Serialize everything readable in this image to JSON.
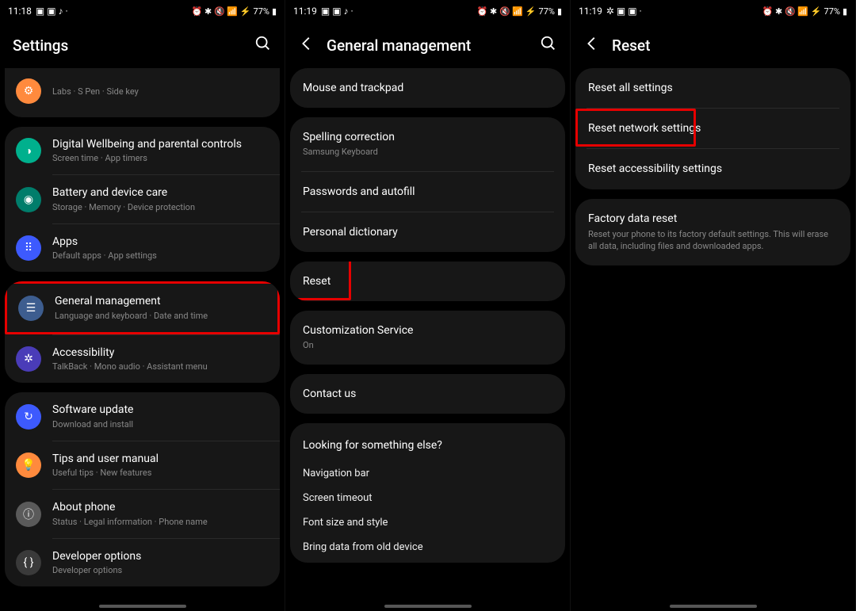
{
  "screen1": {
    "time": "11:18",
    "battery": "77%",
    "title": "Settings",
    "partial_sub": "Labs  ·  S Pen  ·  Side key",
    "items": [
      {
        "title": "Digital Wellbeing and parental controls",
        "sub": "Screen time  ·  App timers",
        "iconClass": "icon-green"
      },
      {
        "title": "Battery and device care",
        "sub": "Storage  ·  Memory  ·  Device protection",
        "iconClass": "icon-teal"
      },
      {
        "title": "Apps",
        "sub": "Default apps  ·  App settings",
        "iconClass": "icon-blue"
      }
    ],
    "items2": [
      {
        "title": "General management",
        "sub": "Language and keyboard  ·  Date and time",
        "iconClass": "icon-slate",
        "highlight": true
      },
      {
        "title": "Accessibility",
        "sub": "TalkBack  ·  Mono audio  ·  Assistant menu",
        "iconClass": "icon-purple"
      }
    ],
    "items3": [
      {
        "title": "Software update",
        "sub": "Download and install",
        "iconClass": "icon-blue"
      },
      {
        "title": "Tips and user manual",
        "sub": "Useful tips  ·  New features",
        "iconClass": "icon-orange"
      },
      {
        "title": "About phone",
        "sub": "Status  ·  Legal information  ·  Phone name",
        "iconClass": "icon-gray"
      },
      {
        "title": "Developer options",
        "sub": "Developer options",
        "iconClass": "icon-dark"
      }
    ]
  },
  "screen2": {
    "time": "11:19",
    "battery": "77%",
    "title": "General management",
    "cards": [
      [
        {
          "title": "Mouse and trackpad"
        }
      ],
      [
        {
          "title": "Spelling correction",
          "sub": "Samsung Keyboard"
        },
        {
          "title": "Passwords and autofill"
        },
        {
          "title": "Personal dictionary"
        }
      ],
      [
        {
          "title": "Reset",
          "highlight": true
        }
      ],
      [
        {
          "title": "Customization Service",
          "sub": "On"
        }
      ],
      [
        {
          "title": "Contact us"
        }
      ]
    ],
    "looking_title": "Looking for something else?",
    "looking_items": [
      "Navigation bar",
      "Screen timeout",
      "Font size and style",
      "Bring data from old device"
    ]
  },
  "screen3": {
    "time": "11:19",
    "battery": "77%",
    "title": "Reset",
    "cards": [
      [
        {
          "title": "Reset all settings"
        },
        {
          "title": "Reset network settings",
          "highlight": true
        },
        {
          "title": "Reset accessibility settings"
        }
      ],
      [
        {
          "title": "Factory data reset",
          "sub": "Reset your phone to its factory default settings. This will erase all data, including files and downloaded apps."
        }
      ]
    ]
  }
}
